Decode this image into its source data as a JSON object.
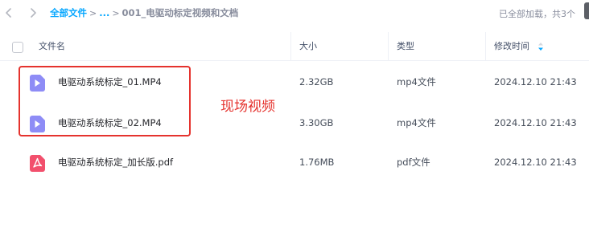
{
  "breadcrumb": {
    "root": "全部文件",
    "ellipsis": "...",
    "current": "001_电驱动标定视频和文档",
    "separator": ">"
  },
  "status_text": "已全部加载，共3个",
  "columns": {
    "name": "文件名",
    "size": "大小",
    "type": "类型",
    "modified": "修改时间"
  },
  "files": [
    {
      "name": "电驱动系统标定_01.MP4",
      "size": "2.32GB",
      "type": "mp4文件",
      "modified": "2024.12.10 21:43",
      "icon": "video-file-icon"
    },
    {
      "name": "电驱动系统标定_02.MP4",
      "size": "3.30GB",
      "type": "mp4文件",
      "modified": "2024.12.10 21:43",
      "icon": "video-file-icon"
    },
    {
      "name": "电驱动系统标定_加长版.pdf",
      "size": "1.76MB",
      "type": "pdf文件",
      "modified": "2024.12.10 21:43",
      "icon": "pdf-file-icon"
    }
  ],
  "annotation": {
    "text": "现场视频"
  },
  "colors": {
    "accent": "#06a7ff",
    "video_icon": "#8e8cf6",
    "pdf_icon": "#f2506d",
    "annotation": "#e5332e"
  }
}
